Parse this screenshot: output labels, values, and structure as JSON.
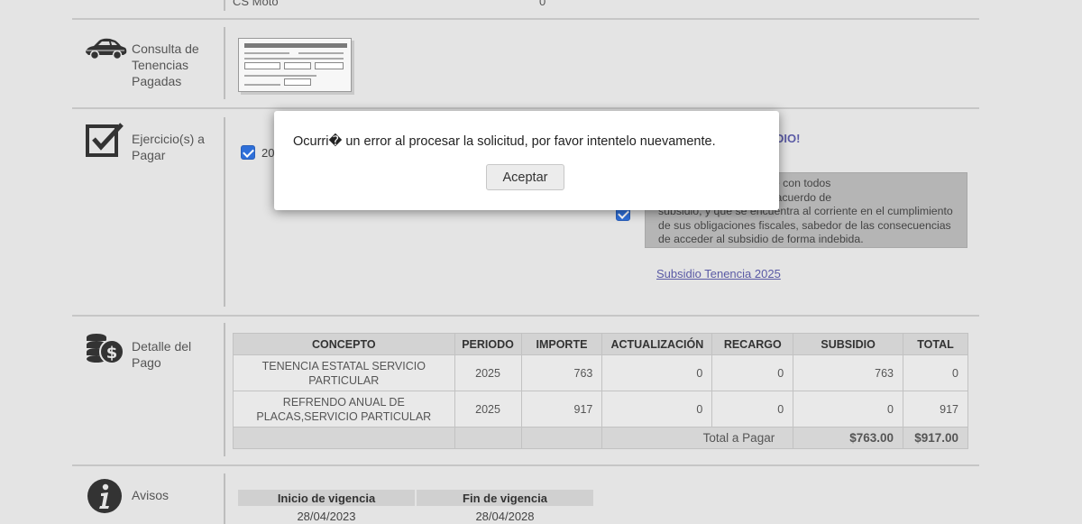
{
  "top_partial": {
    "label": "CS Moto",
    "value": "0"
  },
  "sections": {
    "consulta": {
      "label_lines": [
        "Consulta de",
        "Tenencias",
        "Pagadas"
      ],
      "icon": "car-icon"
    },
    "ejercicios": {
      "label_lines": [
        "Ejercicio(s) a",
        "Pagar"
      ],
      "icon": "checkbox-icon",
      "year_checkbox_text": "20",
      "subsidio_heading": "DIO!",
      "declaration_text": "decir verdad que cumple con todos\nsitos establecidos en el acuerdo de\nsubsidio, y que se encuentra al corriente en el cumplimiento\nde sus obligaciones fiscales, sabedor de las consecuencias\nde acceder al subsidio de forma indebida.",
      "subsidio_link": "Subsidio Tenencia 2025"
    },
    "detalle": {
      "label_lines": [
        "Detalle del",
        "Pago"
      ],
      "icon": "money-icon",
      "table": {
        "headers": [
          "CONCEPTO",
          "PERIODO",
          "IMPORTE",
          "ACTUALIZACIÓN",
          "RECARGO",
          "SUBSIDIO",
          "TOTAL"
        ],
        "rows": [
          [
            "TENENCIA ESTATAL SERVICIO PARTICULAR",
            "2025",
            "763",
            "0",
            "0",
            "763",
            "0"
          ],
          [
            "REFRENDO ANUAL DE PLACAS,SERVICIO PARTICULAR",
            "2025",
            "917",
            "0",
            "0",
            "0",
            "917"
          ]
        ],
        "footer_label": "Total a Pagar",
        "footer_subsidio": "$763.00",
        "footer_total": "$917.00"
      }
    },
    "avisos": {
      "label_lines": [
        "Avisos"
      ],
      "icon": "info-icon",
      "vigencia_headers": [
        "Inicio de vigencia",
        "Fin de vigencia"
      ],
      "vigencia_values": [
        "28/04/2023",
        "28/04/2028"
      ]
    }
  },
  "modal": {
    "message": "Ocurri� un error al procesar la solicitud, por favor intentelo nuevamente.",
    "button_label": "Aceptar"
  },
  "colors": {
    "page_bg": "#e4e4e4",
    "link": "#5a5aa5",
    "checkbox": "#2e6fd9"
  }
}
